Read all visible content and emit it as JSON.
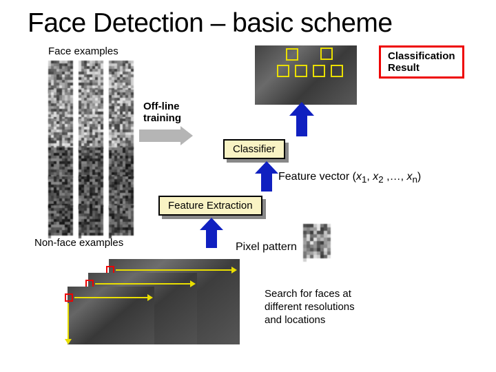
{
  "title": "Face Detection – basic scheme",
  "labels": {
    "face_examples": "Face examples",
    "nonface_examples": "Non-face examples",
    "offline_training": "Off-line\ntraining",
    "classifier": "Classifier",
    "feature_extraction": "Feature Extraction",
    "pixel_pattern": "Pixel pattern",
    "classification_result": "Classification\nResult",
    "feature_vector_prefix": "Feature vector (",
    "fv_x1": "x",
    "fv_sub1": "1",
    "fv_comma1": ", ",
    "fv_x2": "x",
    "fv_sub2": "2",
    "fv_mid": " ,…, ",
    "fv_xn": "x",
    "fv_subn": "n",
    "fv_close": ")",
    "search_text": "Search for faces at\ndifferent resolutions\nand locations"
  }
}
